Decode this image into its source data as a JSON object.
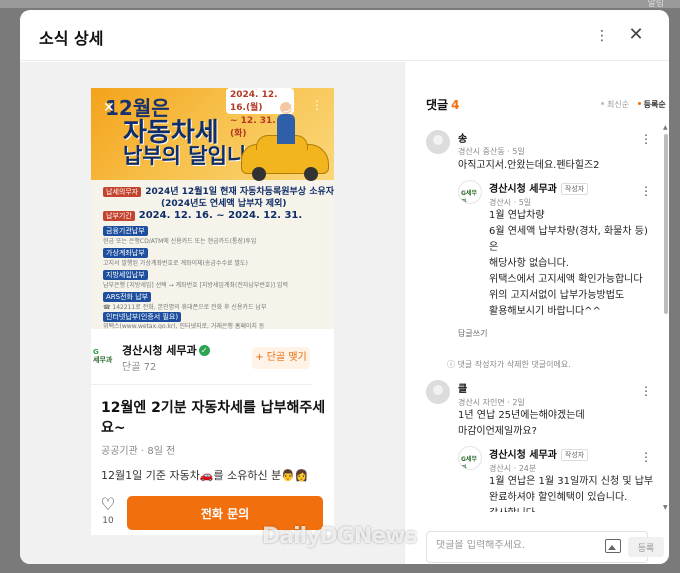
{
  "top_strip": {
    "label": "알림"
  },
  "modal": {
    "title": "소식 상세"
  },
  "poster": {
    "title_line1": "12월은",
    "title_line2": "자동차세",
    "title_line3": "납부의 달입니다",
    "date_line1": "2024. 12. 16.(월)",
    "date_line2": "~ 12. 31.(화)",
    "subject_tag": "납세의무자",
    "subject_text": "2024년 12월1일 현재 자동차등록원부상 소유자",
    "subject_note": "(2024년도 연세액 납부자 제외)",
    "period_tag": "납부기간",
    "period_text": "2024. 12. 16. ~ 2024. 12. 31.",
    "methods": [
      "금융기관납부",
      "가상계좌납부",
      "지방세입납부",
      "ARS전화 납부",
      "인터넷납부(인증서 필요)"
    ],
    "method_notes": [
      "현금 또는 은행CD/ATM에 신용카드 또는 현금카드(통장)투입",
      "고지서 발행된 가상계좌번호로 계좌이체(송금수수료 별도)",
      "납부은행 [지방세입] 선택 → 계좌번호 [지방세입계좌(전자납부번호)] 입력",
      "☎ 142211로 전화, 본인명의 휴대폰으로 전화 후 신용카드 납부",
      "위택스(www.wetax.go.kr), 인터넷지로, 거래은행 홈페이지 등"
    ]
  },
  "org": {
    "logo_text": "세무과",
    "name": "경산시청 세무과",
    "sub": "단골 72",
    "fav_label": "+ 단골 맺기"
  },
  "post": {
    "title": "12월엔 2기분 자동차세를 납부해주세요~",
    "meta": "공공기관 · 8일 전",
    "body": "12월1일 기준 자동차🚗를 소유하신 분👨👩",
    "like_count": "10",
    "call_label": "전화 문의"
  },
  "comments": {
    "label": "댓글",
    "count": "4",
    "sort_options": [
      "최신순",
      "등록순"
    ],
    "items": [
      {
        "name": "송",
        "meta": "경산시 중산동 · 5일",
        "text": "아직고지서.안왔는데요.펜타힐즈2"
      },
      {
        "name": "경산시청 세무과",
        "badge": "작성자",
        "meta": "경산시 · 5일",
        "text": "1월 연납차량\n6월 연세액 납부차량(경차, 화물차 등)\n은\n해당사항 없습니다.\n위택스에서 고지세액 확인가능합니다\n위의 고지서없이 납부가능방법도\n활용해보시기 바랍니다^^"
      },
      {
        "name": "클",
        "meta": "경산시 자인면 · 2일",
        "text": "1년 연납 25년에는해야겠는데\n마감이언제일까요?"
      },
      {
        "name": "경산시청 세무과",
        "badge": "작성자",
        "meta": "경산시 · 24분",
        "text": "1월 연납은 1월 31일까지 신청 및 납부\n완료하셔야 할인혜택이 있습니다.\n감사합니다."
      }
    ],
    "reply_label": "답글쓰기",
    "deleted_notice": "ⓘ 댓글 작성자가 삭제한 댓글이에요.",
    "input_placeholder": "댓글을 입력해주세요.",
    "submit_label": "등록"
  },
  "watermark": "DailyDGNews"
}
